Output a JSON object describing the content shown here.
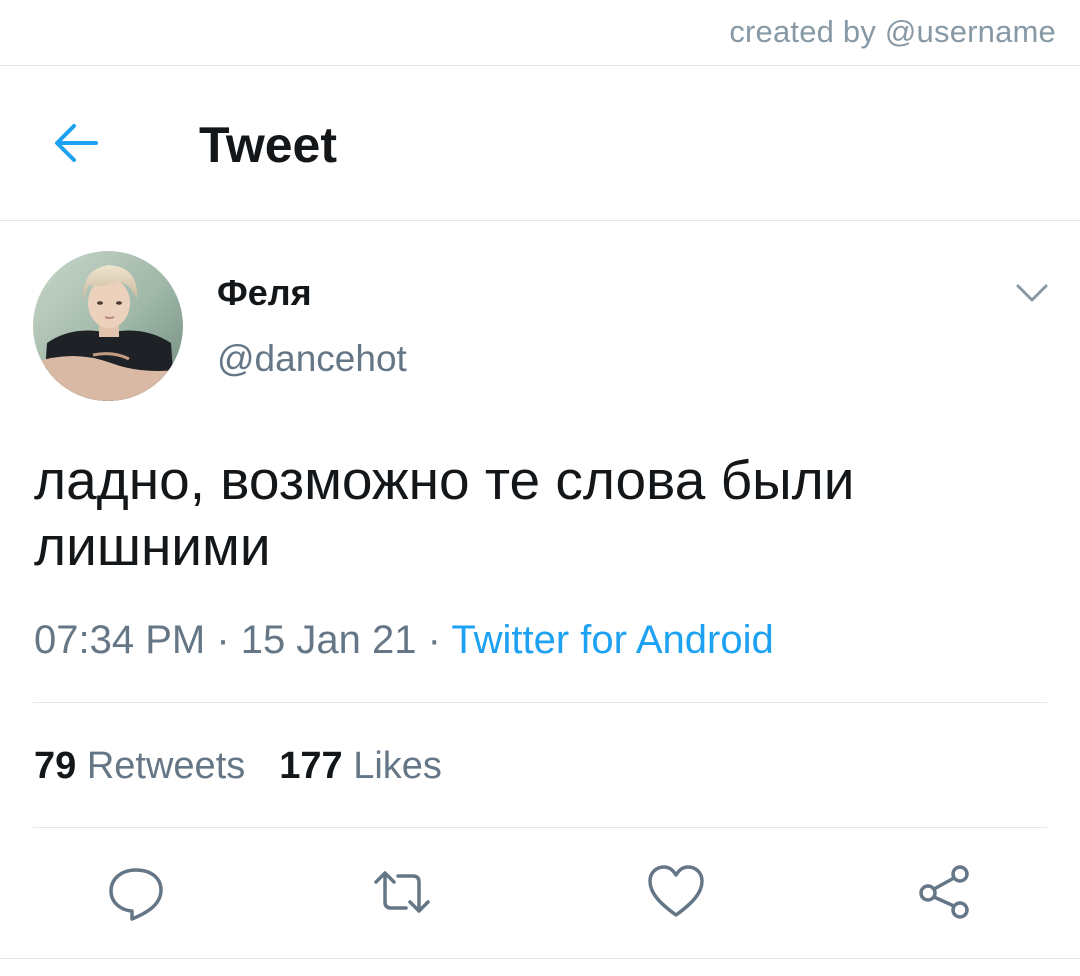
{
  "credit": {
    "text": "created by @username"
  },
  "header": {
    "back_icon": "arrow-left-icon",
    "title": "Tweet"
  },
  "author": {
    "name": "Феля",
    "handle": "@dancehot",
    "avatar": "profile-photo",
    "menu_icon": "chevron-down-icon"
  },
  "tweet": {
    "text": "ладно, возможно те слова были лишними",
    "time": "07:34 PM",
    "date": "15 Jan 21",
    "separator": "·",
    "source": "Twitter for Android"
  },
  "stats": {
    "retweets_count": "79",
    "retweets_label": "Retweets",
    "likes_count": "177",
    "likes_label": "Likes"
  },
  "actions": [
    {
      "icon": "reply-icon"
    },
    {
      "icon": "retweet-icon"
    },
    {
      "icon": "heart-icon"
    },
    {
      "icon": "share-icon"
    }
  ],
  "colors": {
    "accent": "#1da1f2",
    "text_primary": "#14171a",
    "text_secondary": "#657786",
    "divider": "#e1e8ed"
  }
}
